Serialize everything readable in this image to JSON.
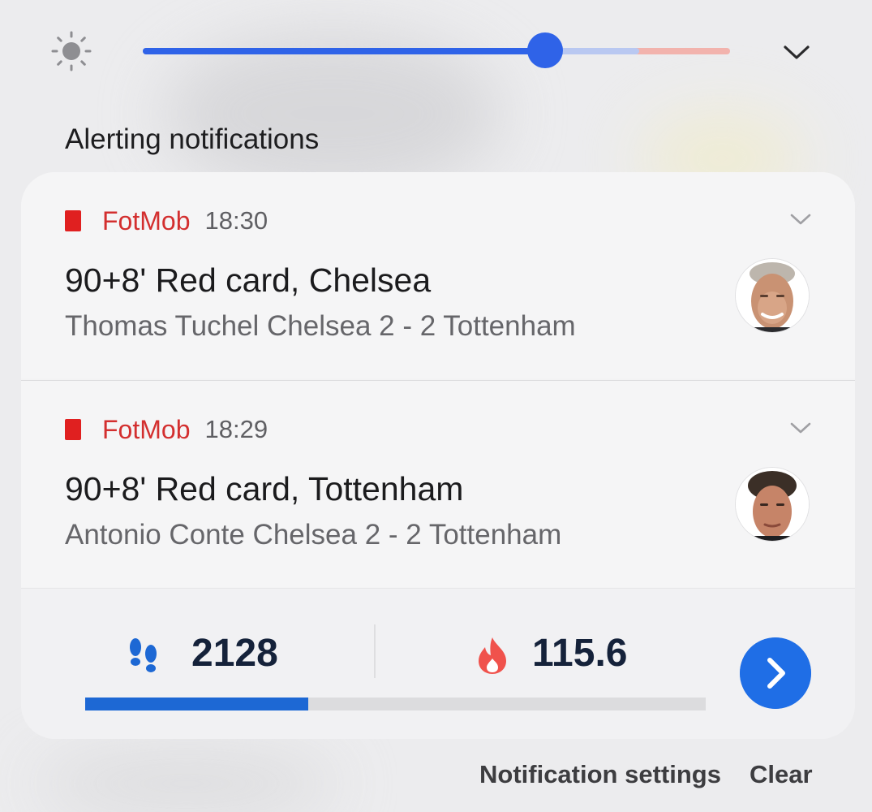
{
  "brightness": {
    "level": 0.685,
    "extra_range_start": 0.845,
    "icon": "sun-icon"
  },
  "section": {
    "title": "Alerting notifications"
  },
  "notifications": [
    {
      "app": "FotMob",
      "time": "18:30",
      "title": "90+8' Red card, Chelsea",
      "text": "Thomas Tuchel Chelsea 2 - 2 Tottenham",
      "avatar": "manager-avatar-tuchel"
    },
    {
      "app": "FotMob",
      "time": "18:29",
      "title": "90+8' Red card, Tottenham",
      "text": "Antonio Conte Chelsea 2 - 2 Tottenham",
      "avatar": "manager-avatar-conte"
    }
  ],
  "health": {
    "steps": "2128",
    "calories": "115.6",
    "progress": 0.36,
    "steps_icon": "footsteps-icon",
    "calories_icon": "flame-icon"
  },
  "footer": {
    "settings_label": "Notification settings",
    "clear_label": "Clear"
  },
  "colors": {
    "accent": "#2f63e8",
    "fotmob_red": "#e02020",
    "health_blue": "#1d68d4",
    "flame": "#f0524c"
  }
}
